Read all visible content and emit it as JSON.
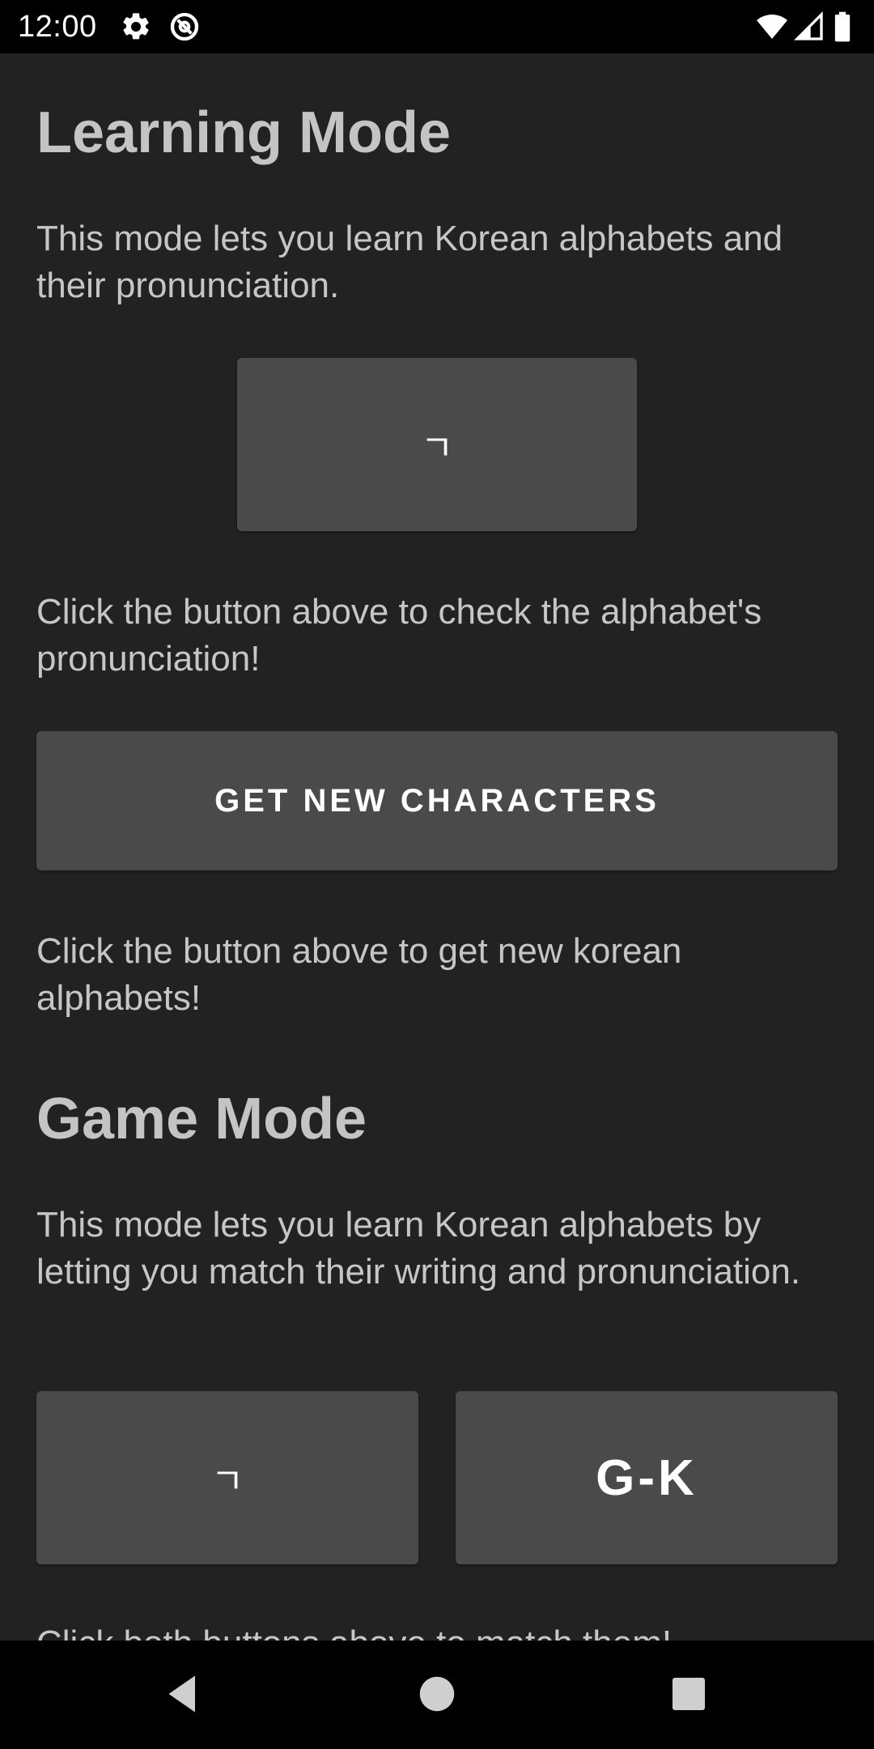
{
  "status_bar": {
    "time": "12:00",
    "icons": [
      "gear-icon",
      "at-sign-icon",
      "wifi-icon",
      "signal-icon",
      "battery-icon"
    ]
  },
  "learning_mode": {
    "title": "Learning Mode",
    "description": "This mode lets you learn Korean alphabets and their pronunciation.",
    "character_button": "ㄱ",
    "character_hint": "Click the button above to check the alphabet's pronunciation!",
    "new_characters_button": "GET NEW CHARACTERS",
    "new_characters_hint": "Click the button above to get new korean alphabets!"
  },
  "game_mode": {
    "title": "Game Mode",
    "description": "This mode lets you learn Korean alphabets by letting you match their writing and pronunciation.",
    "writing_button": "ㄱ",
    "pronunciation_button": "G-K",
    "match_hint": "Click both buttons above to match them!"
  },
  "nav_bar": {
    "icons": [
      "back-icon",
      "home-icon",
      "recents-icon"
    ]
  },
  "colors": {
    "background": "#222222",
    "button": "#4a4a4a",
    "text": "#c6c6c6",
    "system_bar": "#000000"
  }
}
